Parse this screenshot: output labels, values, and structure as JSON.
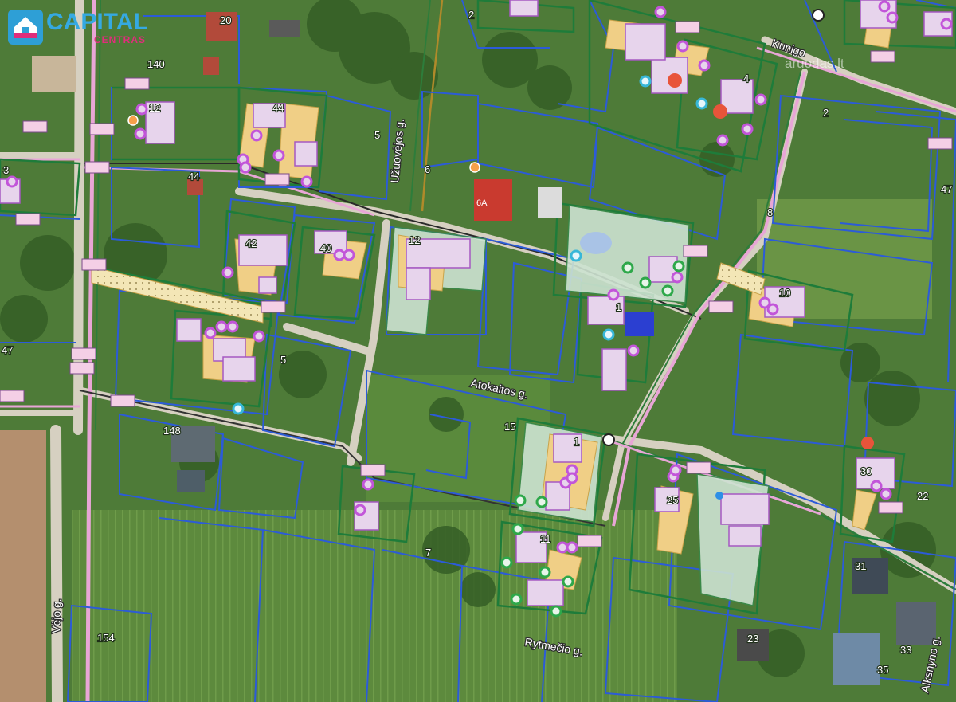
{
  "logo": {
    "brand": "CAPITAL",
    "sub": "CENTRAS"
  },
  "watermark": "aruodas.lt",
  "streets": {
    "uzuovejos": "Užuovėjos g.",
    "atokaitos": "Atokaitos g.",
    "rytmecio": "Rytmečio g.",
    "vejo": "Vėjo g.",
    "alksnyno": "Alksnyno g.",
    "kunigo": "Kunigo"
  },
  "parcel_labels": {
    "p20": "20",
    "p140": "140",
    "p2top": "2",
    "p12": "12",
    "p44a": "44",
    "p5a": "5",
    "p6": "6",
    "p6a": "6A",
    "p44b": "44",
    "p3": "3",
    "p42": "42",
    "p40": "40",
    "p12b": "12",
    "p8": "8",
    "p2right": "2",
    "p47right": "47",
    "p10": "10",
    "p5b": "5",
    "p47left": "47",
    "p148": "148",
    "p15": "15",
    "p7": "7",
    "p22": "22",
    "p31": "31",
    "p154": "154",
    "p23": "23",
    "p33": "33",
    "p35": "35",
    "p25": "25",
    "p1": "1",
    "p11": "11",
    "p30": "30",
    "p4": "4",
    "p1b": "1"
  },
  "colors": {
    "grass": "#4e7b38",
    "field": "#5f8a3e",
    "parcel_outline": "#2c5bd8",
    "plot_outline": "#1e7c3a",
    "building": "#e7d4ec",
    "building_outline": "#b169c9",
    "planned_zone": "#cde3d1",
    "yellow_zone": "#f0cf86",
    "road": "#d6d0c1",
    "utility_pink": "#e8a6d6",
    "marker_purple": "#c255d9",
    "marker_green": "#2ea84a",
    "marker_cyan": "#38b7d8",
    "marker_orange": "#f0822d"
  }
}
